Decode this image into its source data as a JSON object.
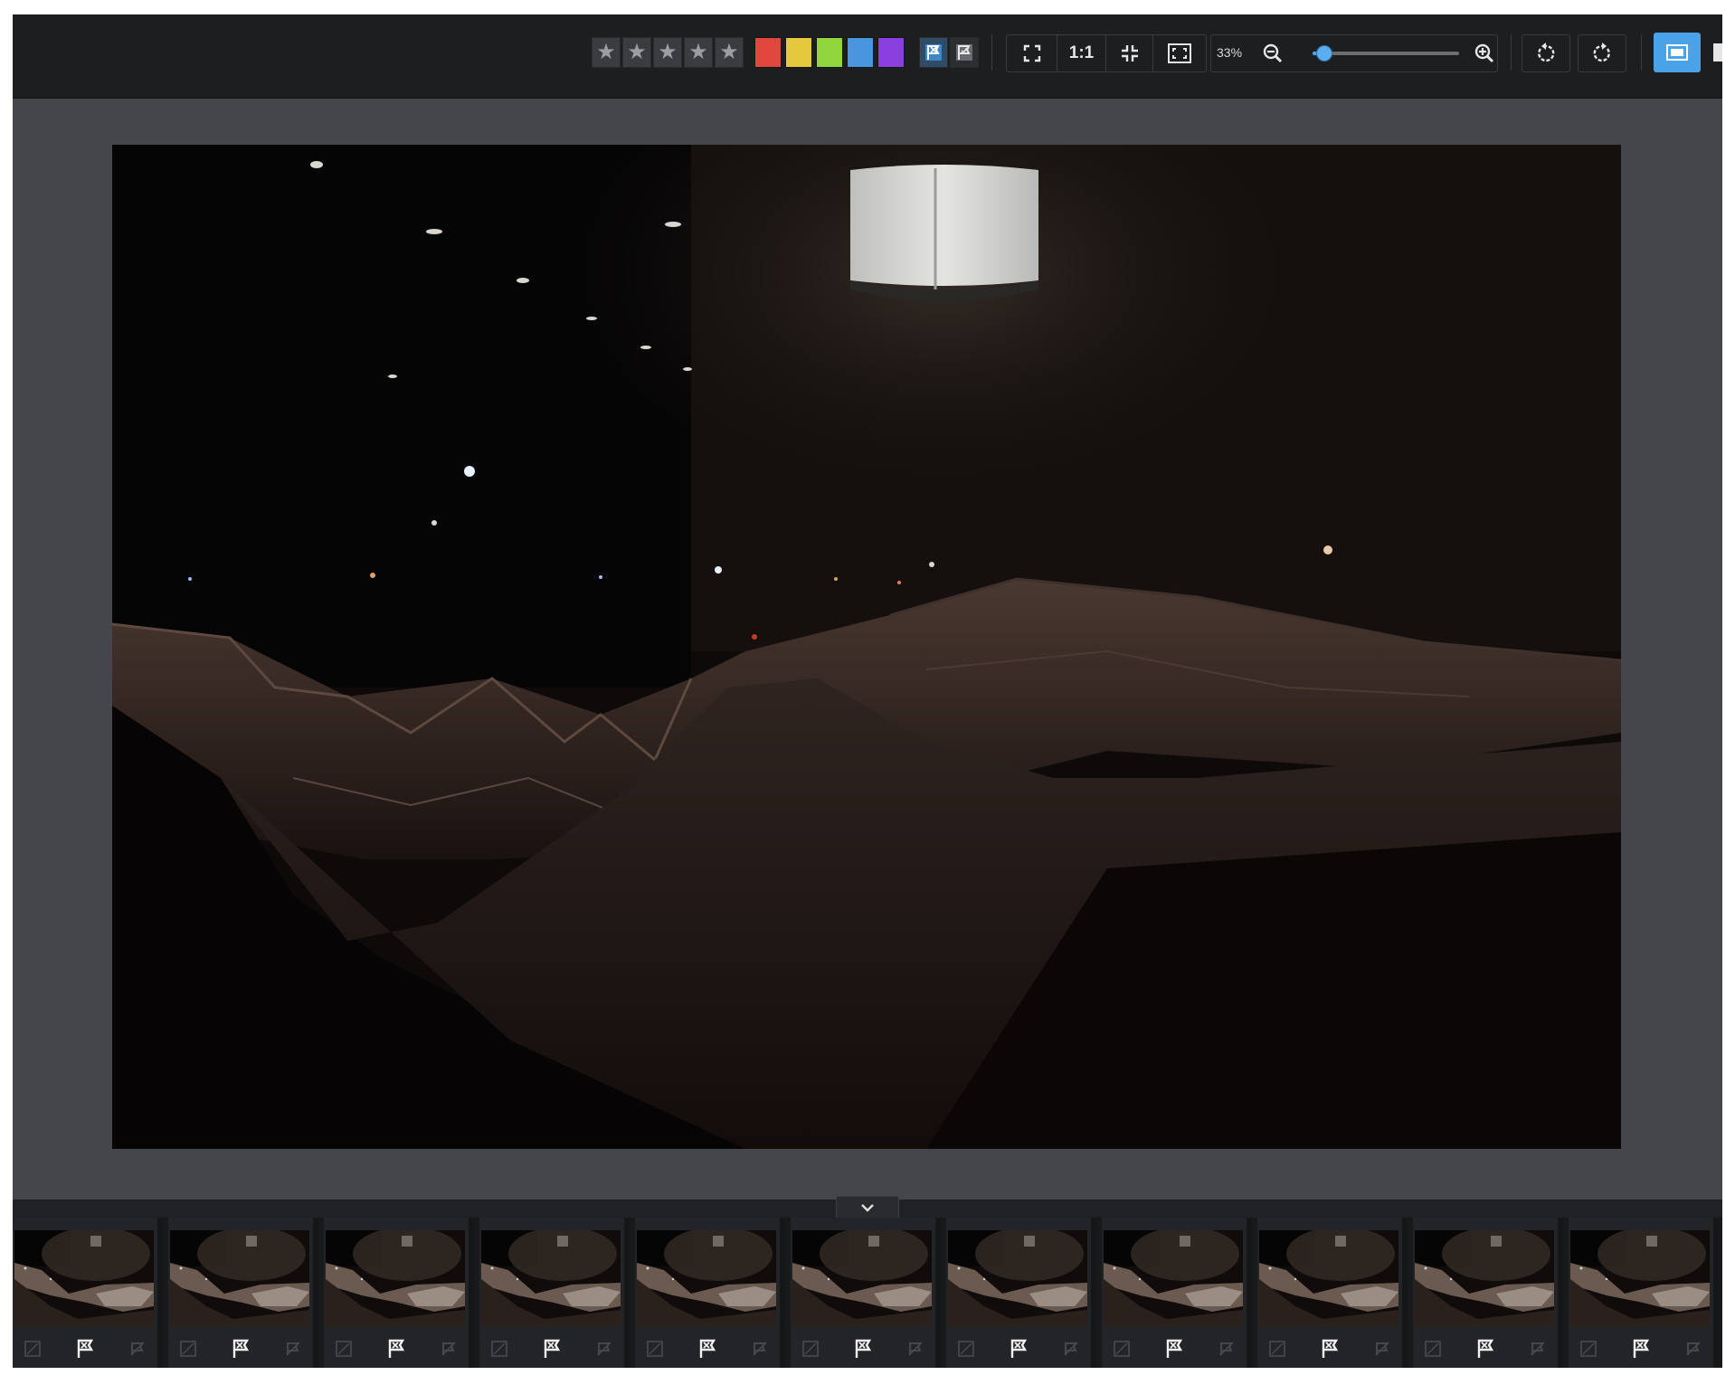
{
  "toolbar": {
    "rating_stars": [
      "★",
      "★",
      "★",
      "★",
      "★"
    ],
    "color_labels": [
      {
        "name": "red",
        "hex": "#e0483e"
      },
      {
        "name": "yellow",
        "hex": "#e6c83d"
      },
      {
        "name": "green",
        "hex": "#8fd63f"
      },
      {
        "name": "blue",
        "hex": "#4a95e0"
      },
      {
        "name": "purple",
        "hex": "#8a3fe0"
      }
    ],
    "flag_buttons": [
      {
        "icon": "flag-picked-icon",
        "active": true
      },
      {
        "icon": "flag-rejected-icon",
        "active": false
      }
    ],
    "view_buttons": [
      {
        "icon": "fullscreen-icon",
        "label": ""
      },
      {
        "icon": "actual-size-icon",
        "label": "1:1"
      },
      {
        "icon": "shrink-icon",
        "label": ""
      },
      {
        "icon": "fit-to-screen-icon",
        "label": ""
      }
    ],
    "zoom": {
      "label": "33%",
      "value": 0.04
    },
    "rotate_buttons": [
      {
        "icon": "rotate-left-icon"
      },
      {
        "icon": "rotate-right-icon"
      }
    ],
    "layout_toggle": {
      "icon": "single-view-icon",
      "active": true
    },
    "accent_color": "#4aa3e8"
  },
  "viewer": {
    "image_subject_icon": "dark-interior-photo"
  },
  "filmstrip": {
    "collapse_icon": "chevron-down-icon",
    "frames": [
      {
        "flag": "picked"
      },
      {
        "flag": "picked"
      },
      {
        "flag": "picked"
      },
      {
        "flag": "picked"
      },
      {
        "flag": "picked"
      },
      {
        "flag": "picked"
      },
      {
        "flag": "picked"
      },
      {
        "flag": "picked"
      },
      {
        "flag": "picked"
      },
      {
        "flag": "picked"
      },
      {
        "flag": "picked"
      }
    ]
  }
}
